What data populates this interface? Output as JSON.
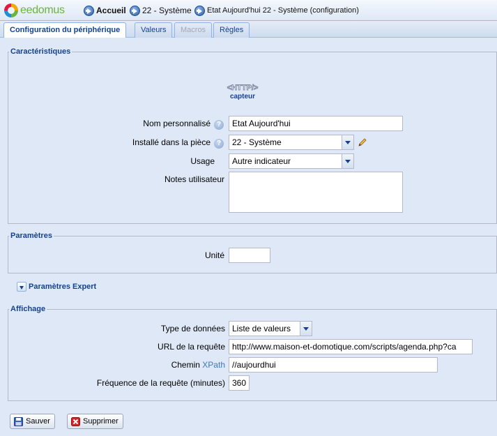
{
  "header": {
    "logo_text": "eedomus",
    "breadcrumbs": [
      {
        "label": "Accueil"
      },
      {
        "label": "22 - Système"
      },
      {
        "label": "Etat Aujourd'hui 22 - Système (configuration)"
      }
    ]
  },
  "tabs": [
    {
      "label": "Configuration du périphérique",
      "state": "active"
    },
    {
      "label": "Valeurs",
      "state": "normal"
    },
    {
      "label": "Macros",
      "state": "disabled"
    },
    {
      "label": "Règles",
      "state": "normal"
    }
  ],
  "caracteristiques": {
    "title": "Caractéristiques",
    "device_icon": "http-icon",
    "device_icon_text": "<HTTP/>",
    "device_type": "capteur",
    "nom_label": "Nom personnalisé",
    "nom_value": "Etat Aujourd'hui",
    "piece_label": "Installé dans la pièce",
    "piece_value": "22 - Système",
    "usage_label": "Usage",
    "usage_value": "Autre indicateur",
    "notes_label": "Notes utilisateur",
    "notes_value": ""
  },
  "parametres": {
    "title": "Paramètres",
    "unite_label": "Unité",
    "unite_value": ""
  },
  "parametres_expert": {
    "title": "Paramètres Expert"
  },
  "affichage": {
    "title": "Affichage",
    "type_label": "Type de données",
    "type_value": "Liste de valeurs",
    "url_label": "URL de la requête",
    "url_value": "http://www.maison-et-domotique.com/scripts/agenda.php?ca",
    "chemin_label_prefix": "Chemin",
    "chemin_label_link": "XPath",
    "chemin_value": "//aujourdhui",
    "frequence_label": "Fréquence de la requête (minutes)",
    "frequence_value": "360"
  },
  "actions": {
    "save_label": "Sauver",
    "delete_label": "Supprimer"
  },
  "colors": {
    "accent": "#15428b",
    "panel_bg": "#dfe8f6",
    "border": "#99bbe8",
    "link": "#3b78c4"
  }
}
